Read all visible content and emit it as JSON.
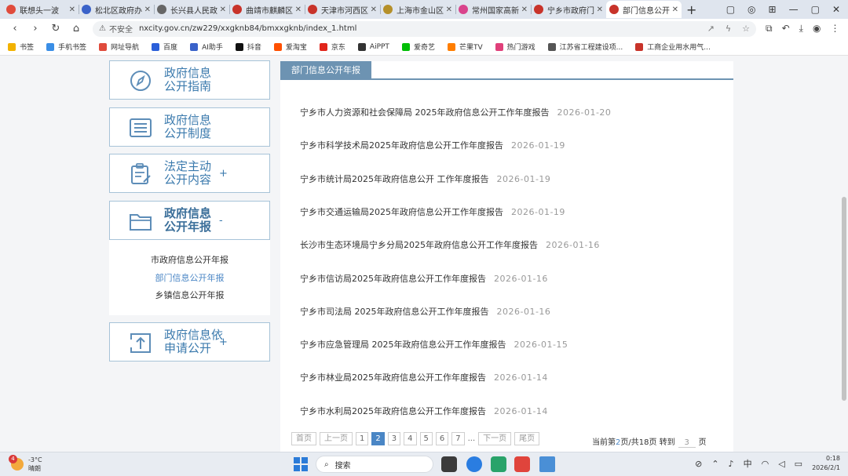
{
  "browser": {
    "tabs": [
      {
        "title": "联想头一波",
        "color": "#e04b3c"
      },
      {
        "title": "松北区政府办公",
        "color": "#3a62c9"
      },
      {
        "title": "长兴县人民政府",
        "color": "#666666"
      },
      {
        "title": "曲靖市麒麟区",
        "color": "#c8332a"
      },
      {
        "title": "天津市河西区",
        "color": "#c8332a"
      },
      {
        "title": "上海市金山区",
        "color": "#b5902a"
      },
      {
        "title": "常州国家高新区",
        "color": "#d9438c"
      },
      {
        "title": "宁乡市政府门户",
        "color": "#c8332a"
      },
      {
        "title": "部门信息公开年报",
        "color": "#c8332a",
        "active": true
      }
    ],
    "new_tab": "+",
    "window_controls": [
      "▢",
      "◎",
      "⊞",
      "—",
      "▢",
      "✕"
    ],
    "nav": {
      "back": "‹",
      "forward": "›",
      "reload": "↻",
      "home": "⌂"
    },
    "address": {
      "security": "不安全",
      "url": "nxcity.gov.cn/zw229/xxgknb84/bmxxgknb/index_1.html"
    },
    "bookmarks": [
      {
        "label": "书签",
        "color": "#f2b200"
      },
      {
        "label": "手机书签",
        "color": "#3a8ee6"
      },
      {
        "label": "网址导航",
        "color": "#e04b3c"
      },
      {
        "label": "百度",
        "color": "#2b5fd9"
      },
      {
        "label": "AI助手",
        "color": "#3a62c9"
      },
      {
        "label": "抖音",
        "color": "#111111"
      },
      {
        "label": "爱淘宝",
        "color": "#ff5000"
      },
      {
        "label": "京东",
        "color": "#e1251b"
      },
      {
        "label": "AiPPT",
        "color": "#333333"
      },
      {
        "label": "爱奇艺",
        "color": "#00be06"
      },
      {
        "label": "芒果TV",
        "color": "#ff7e00"
      },
      {
        "label": "热门游戏",
        "color": "#e0407a"
      },
      {
        "label": "江苏省工程建设项...",
        "color": "#555555"
      },
      {
        "label": "工商企业用水用气...",
        "color": "#c8332a"
      }
    ]
  },
  "sidebar": {
    "items": [
      {
        "label1": "政府信息",
        "label2": "公开指南",
        "sign": "",
        "icon": "compass-icon"
      },
      {
        "label1": "政府信息",
        "label2": "公开制度",
        "sign": "",
        "icon": "list-icon"
      },
      {
        "label1": "法定主动",
        "label2": "公开内容",
        "sign": "+",
        "icon": "clipboard-icon"
      },
      {
        "label1": "政府信息",
        "label2": "公开年报",
        "sign": "-",
        "icon": "folder-icon"
      },
      {
        "label1": "政府信息依",
        "label2": "申请公开",
        "sign": "+",
        "icon": "upload-icon"
      }
    ],
    "submenu": [
      "市政府信息公开年报",
      "部门信息公开年报",
      "乡镇信息公开年报"
    ]
  },
  "main": {
    "heading": "部门信息公开年报",
    "articles": [
      {
        "title": "宁乡市人力资源和社会保障局 2025年政府信息公开工作年度报告",
        "date": "2026-01-20"
      },
      {
        "title": "宁乡市科学技术局2025年政府信息公开工作年度报告",
        "date": "2026-01-19"
      },
      {
        "title": "宁乡市统计局2025年政府信息公开 工作年度报告",
        "date": "2026-01-19"
      },
      {
        "title": "宁乡市交通运输局2025年政府信息公开工作年度报告",
        "date": "2026-01-19"
      },
      {
        "title": "长沙市生态环境局宁乡分局2025年政府信息公开工作年度报告",
        "date": "2026-01-16"
      },
      {
        "title": "宁乡市信访局2025年政府信息公开工作年度报告",
        "date": "2026-01-16"
      },
      {
        "title": "宁乡市司法局 2025年政府信息公开工作年度报告",
        "date": "2026-01-16"
      },
      {
        "title": "宁乡市应急管理局 2025年政府信息公开工作年度报告",
        "date": "2026-01-15"
      },
      {
        "title": "宁乡市林业局2025年政府信息公开工作年度报告",
        "date": "2026-01-14"
      },
      {
        "title": "宁乡市水利局2025年政府信息公开工作年度报告",
        "date": "2026-01-14"
      }
    ],
    "pager": {
      "first": "首页",
      "prev": "上一页",
      "pages": [
        "1",
        "2",
        "3",
        "4",
        "5",
        "6",
        "7"
      ],
      "current": "2",
      "ellipsis": "...",
      "next": "下一页",
      "last": "尾页",
      "info_prefix": "当前第",
      "info_current": "2",
      "info_mid": "页/共18页 转到",
      "goto_value": "3",
      "info_suffix": "页"
    }
  },
  "taskbar": {
    "weather_badge": "4",
    "temperature": "-3°C",
    "condition": "晴朗",
    "search_placeholder": "搜索",
    "tray_ime": "中",
    "time": "0:18",
    "date": "2026/2/1"
  }
}
